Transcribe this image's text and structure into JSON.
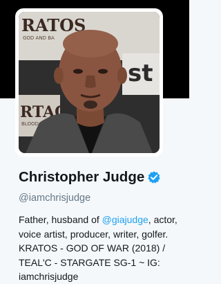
{
  "colors": {
    "background": "#f5f8fa",
    "banner": "#000000",
    "text_primary": "#14171a",
    "text_secondary": "#657786",
    "link": "#1da1f2",
    "verified_badge": "#1da1f2"
  },
  "banner": {
    "poster_text_top": "RATOS",
    "poster_text_top_sub": "GOD AND BA",
    "poster_text_right": "st",
    "poster_text_bottom": "RTAC",
    "poster_text_bottom_sub": "BLOOD AN"
  },
  "profile": {
    "display_name": "Christopher Judge",
    "verified_icon": "verified-badge-icon",
    "screen_name": "@iamchrisjudge",
    "bio": {
      "line1_prefix": "Father, husband of ",
      "line1_mention": "@giajudge",
      "line1_suffix": ", actor,",
      "line2": "voice artist, producer, writer, golfer.",
      "line3": "KRATOS - GOD OF WAR (2018) /",
      "line4": "TEAL'C - STARGATE SG-1 ~ IG:",
      "line5": "iamchrisjudge"
    }
  }
}
